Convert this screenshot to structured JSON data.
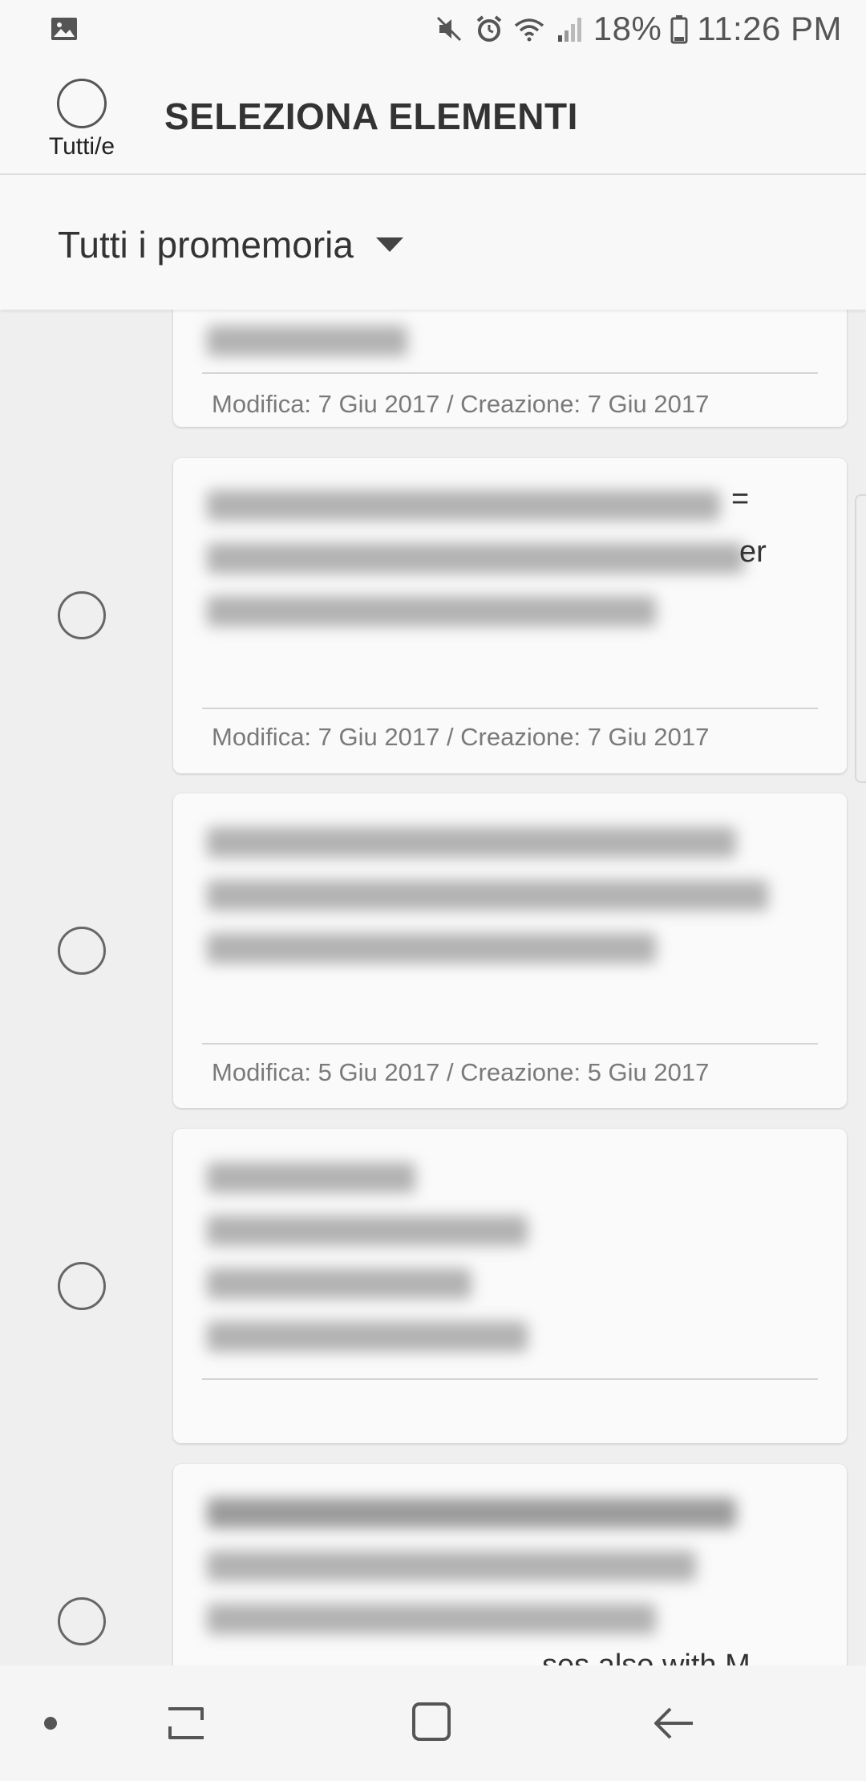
{
  "status_bar": {
    "battery": "18%",
    "time": "11:26 PM",
    "icons": [
      "gallery-icon",
      "mute-icon",
      "alarm-icon",
      "wifi-icon",
      "signal-icon",
      "battery-icon"
    ]
  },
  "header": {
    "select_all_label": "Tutti/e",
    "title": "SELEZIONA ELEMENTI"
  },
  "filter": {
    "label": "Tutti i promemoria"
  },
  "items": [
    {
      "meta": "Modifica: 7 Giu 2017 / Creazione: 7 Giu 2017"
    },
    {
      "meta": "Modifica: 7 Giu 2017 / Creazione: 7 Giu 2017",
      "peek_1": "=",
      "peek_2": "er"
    },
    {
      "meta": "Modifica: 5 Giu 2017 / Creazione: 5 Giu 2017"
    },
    {
      "meta": ""
    },
    {
      "peek_1": "ses also with M"
    }
  ],
  "nav": {
    "icons": [
      "dot-icon",
      "recents-icon",
      "home-icon",
      "back-icon"
    ]
  }
}
